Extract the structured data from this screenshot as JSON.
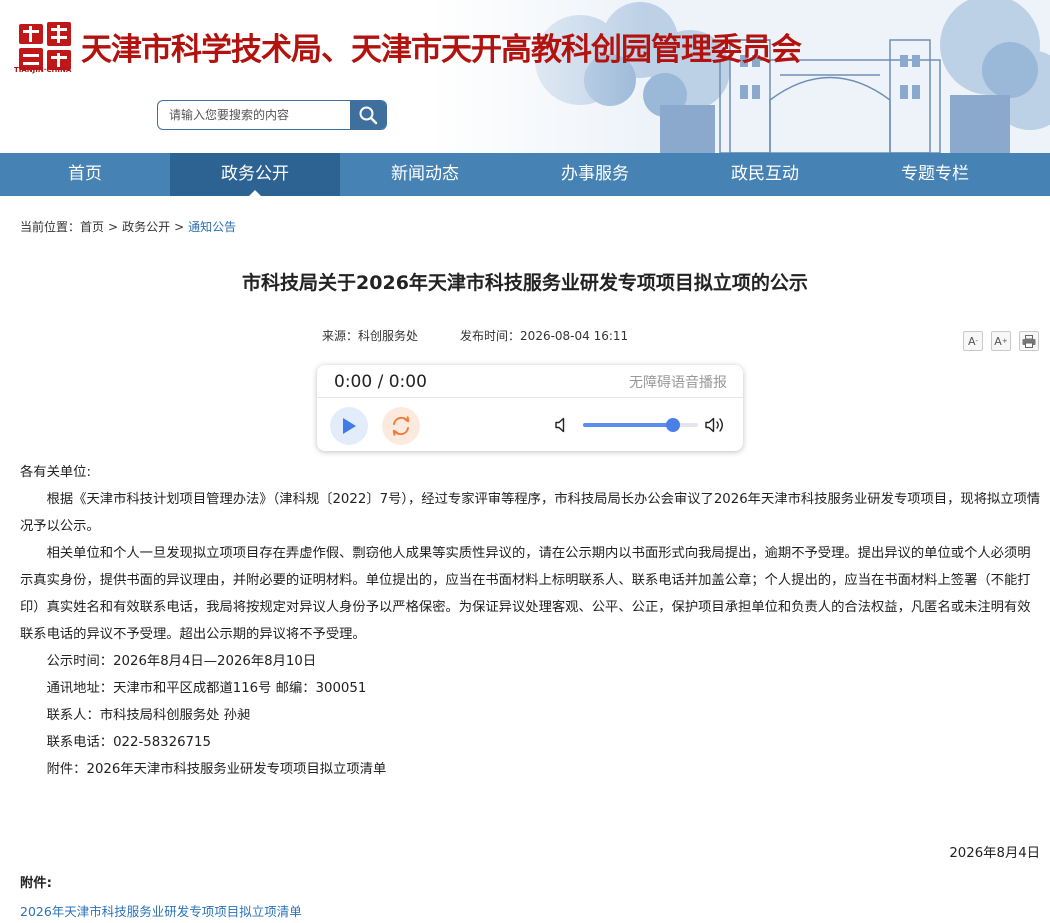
{
  "header": {
    "site_title": "天津市科学技术局、天津市天开高教科创园管理委员会",
    "logo_text": "TIANJIN·CHINA",
    "search_placeholder": "请输入您要搜索的内容"
  },
  "nav": {
    "items": [
      {
        "label": "首页"
      },
      {
        "label": "政务公开",
        "active": true
      },
      {
        "label": "新闻动态"
      },
      {
        "label": "办事服务"
      },
      {
        "label": "政民互动"
      },
      {
        "label": "专题专栏"
      }
    ]
  },
  "breadcrumb": {
    "prefix": "当前位置：",
    "items": [
      "首页",
      "政务公开",
      "通知公告"
    ]
  },
  "article": {
    "title": "市科技局关于2026年天津市科技服务业研发专项项目拟立项的公示",
    "source_label": "来源：",
    "source": "科创服务处",
    "date_label": "发布时间：",
    "date": "2026-08-04 16:11",
    "tools": {
      "font_smaller": "A",
      "font_larger": "A",
      "print": "print-icon"
    }
  },
  "player": {
    "time": "0:00 / 0:00",
    "label": "无障碍语音播报",
    "volume": 0.78
  },
  "content": {
    "salutation": "各有关单位:",
    "paragraphs": [
      "根据《天津市科技计划项目管理办法》（津科规〔2022〕7号），经过专家评审等程序，市科技局局长办公会审议了2026年天津市科技服务业研发专项项目，现将拟立项情况予以公示。",
      "相关单位和个人一旦发现拟立项项目存在弄虚作假、剽窃他人成果等实质性异议的，请在公示期内以书面形式向我局提出，逾期不予受理。提出异议的单位或个人必须明示真实身份，提供书面的异议理由，并附必要的证明材料。单位提出的，应当在书面材料上标明联系人、联系电话并加盖公章；个人提出的，应当在书面材料上签署（不能打印）真实姓名和有效联系电话，我局将按规定对异议人身份予以严格保密。为保证异议处理客观、公平、公正，保护项目承担单位和负责人的合法权益，凡匿名或未注明有效联系电话的异议不予受理。超出公示期的异议将不予受理。"
    ],
    "lines": [
      "公示时间：2026年8月4日—2026年8月10日",
      "通讯地址：天津市和平区成都道116号   邮编：300051",
      "联系人：市科技局科创服务处   孙昶",
      "联系电话：022-58326715",
      "附件：2026年天津市科技服务业研发专项项目拟立项清单"
    ],
    "date_line": "2026年8月4日"
  },
  "attachments": {
    "heading": "附件:",
    "items": [
      "2026年天津市科技服务业研发专项项目拟立项清单"
    ]
  }
}
